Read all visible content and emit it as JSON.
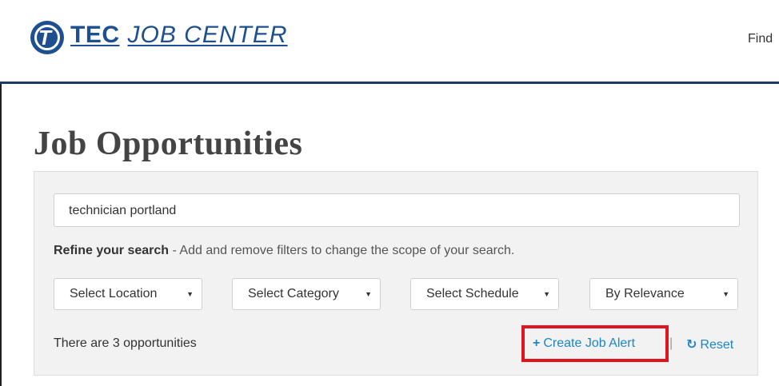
{
  "header": {
    "logo_tec": "TEC",
    "logo_job_center": "JOB CENTER",
    "nav_find": "Find"
  },
  "page": {
    "title": "Job Opportunities"
  },
  "search": {
    "query": "technician portland",
    "refine_bold": "Refine your search",
    "refine_text": " - Add and remove filters to change the scope of your search."
  },
  "filters": {
    "location": "Select Location",
    "category": "Select Category",
    "schedule": "Select Schedule",
    "sort": "By Relevance",
    "caret": "▼"
  },
  "results": {
    "count_text": "There are 3 opportunities"
  },
  "actions": {
    "create_alert_icon": "+",
    "create_alert": "Create Job Alert",
    "separator": "|",
    "reset_icon": "↻",
    "reset": "Reset",
    "highlight_color": "#e0141e",
    "link_color": "#1a86c8"
  }
}
